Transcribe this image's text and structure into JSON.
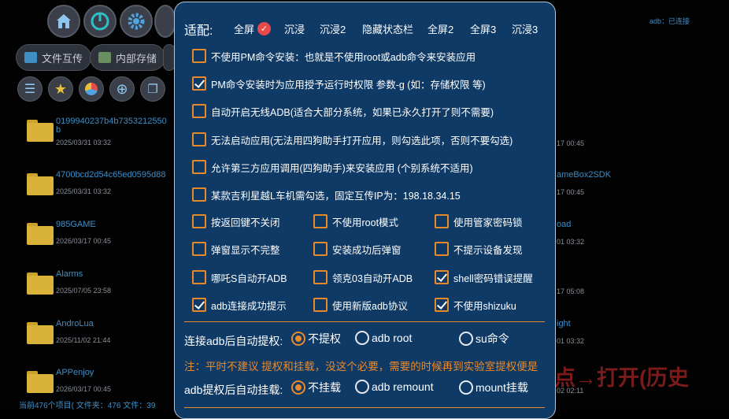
{
  "background": {
    "status_right": "adb：已连接",
    "toolbar_buttons": [
      "home-icon",
      "power-icon",
      "settings-icon"
    ],
    "tabs": [
      {
        "label": "文件互传",
        "icon": "share-icon"
      },
      {
        "label": "内部存储",
        "icon": "storage-icon"
      }
    ],
    "files": [
      {
        "name": "0199940237b4b7353212550",
        "name2": "b",
        "date": "2025/03/31 03:32"
      },
      {
        "name": "4700bcd2d54c65ed0595d88",
        "date": "2025/03/31 03:32"
      },
      {
        "name": "985GAME",
        "date": "2026/03/17 00:45"
      },
      {
        "name": "Alarms",
        "date": "2025/07/05 23:58"
      },
      {
        "name": "AndroLua",
        "date": "2025/11/02 21:44"
      },
      {
        "name": "APPenjoy",
        "date": "2026/03/17 00:45"
      }
    ],
    "right_col": [
      {
        "date": "17 00:45"
      },
      {
        "name": "ameBox2SDK",
        "date": "17 00:45"
      },
      {
        "name": "oad",
        "date": "01 03:32"
      },
      {
        "date": "17 05:08"
      },
      {
        "name": "ight",
        "date": "01 03:32"
      },
      {
        "date": "02 02:11"
      }
    ],
    "footer": "当前476个项目( 文件夹：476   文件：39",
    "overlay_text": "点→打开(历史"
  },
  "dialog": {
    "header": "适配:",
    "modes": [
      {
        "label": "全屏",
        "selected": true
      },
      {
        "label": "沉浸"
      },
      {
        "label": "沉浸2"
      },
      {
        "label": "隐藏状态栏"
      },
      {
        "label": "全屏2"
      },
      {
        "label": "全屏3"
      },
      {
        "label": "沉浸3"
      }
    ],
    "full_rows": [
      {
        "label": "不使用PM命令安装：也就是不使用root或adb命令来安装应用",
        "checked": false
      },
      {
        "label": "PM命令安装时为应用授予运行时权限 参数-g (如：存储权限 等)",
        "checked": true
      },
      {
        "label": "自动开启无线ADB(适合大部分系统，如果已永久打开了则不需要)",
        "checked": false
      },
      {
        "label": "无法启动应用(无法用四狗助手打开应用，则勾选此项，否则不要勾选)",
        "checked": false
      },
      {
        "label": "允许第三方应用调用(四狗助手)来安装应用 (个别系统不适用)",
        "checked": false
      },
      {
        "label": "某款吉利星越L车机需勾选，固定互传IP为：198.18.34.15",
        "checked": false
      }
    ],
    "grid": [
      [
        {
          "label": "按返回键不关闭",
          "checked": false
        },
        {
          "label": "不使用root模式",
          "checked": false
        },
        {
          "label": "使用管家密码锁",
          "checked": false
        }
      ],
      [
        {
          "label": "弹窗显示不完整",
          "checked": false
        },
        {
          "label": "安装成功后弹窗",
          "checked": false
        },
        {
          "label": "不提示设备发现",
          "checked": false
        }
      ],
      [
        {
          "label": "哪吒S自动开ADB",
          "checked": false
        },
        {
          "label": "领克03自动开ADB",
          "checked": false
        },
        {
          "label": "shell密码错误提醒",
          "checked": true
        }
      ],
      [
        {
          "label": "adb连接成功提示",
          "checked": true
        },
        {
          "label": "使用新版adb协议",
          "checked": false
        },
        {
          "label": "不使用shizuku",
          "checked": true
        }
      ]
    ],
    "elevate": {
      "label": "连接adb后自动提权:",
      "options": [
        {
          "label": "不提权",
          "selected": true
        },
        {
          "label": "adb root",
          "selected": false
        },
        {
          "label": "su命令",
          "selected": false
        }
      ]
    },
    "note": "注：平时不建议 提权和挂载，没这个必要，需要的时候再到实验室提权便是",
    "mount": {
      "label": "adb提权后自动挂载:",
      "options": [
        {
          "label": "不挂载",
          "selected": true
        },
        {
          "label": "adb remount",
          "selected": false
        },
        {
          "label": "mount挂载",
          "selected": false
        }
      ]
    },
    "colors": {
      "accent": "#e98a2a",
      "panel": "#0f3a66",
      "check_badge": "#e64a4a"
    }
  }
}
